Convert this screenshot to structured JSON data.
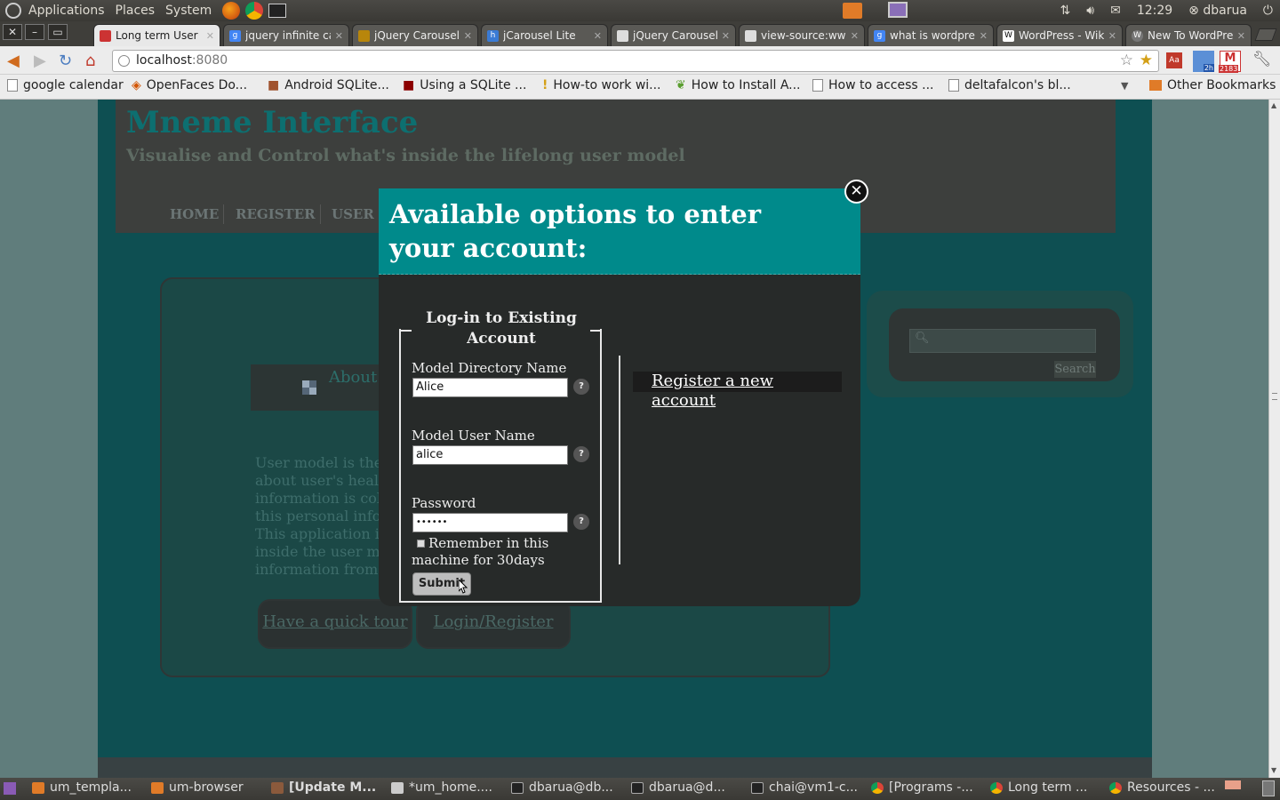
{
  "top_panel": {
    "menus": [
      "Applications",
      "Places",
      "System"
    ],
    "clock": "12:29",
    "user": "dbarua"
  },
  "tabs": [
    {
      "title": "Long term User M",
      "active": true
    },
    {
      "title": "jquery infinite ca",
      "active": false
    },
    {
      "title": "jQuery Carousel F",
      "active": false
    },
    {
      "title": "jCarousel Lite",
      "active": false
    },
    {
      "title": "jQuery Carousel",
      "active": false
    },
    {
      "title": "view-source:www",
      "active": false
    },
    {
      "title": "what is wordpres",
      "active": false
    },
    {
      "title": "WordPress - Wiki",
      "active": false
    },
    {
      "title": "New To WordPre",
      "active": false
    }
  ],
  "toolbar": {
    "url_host": "localhost",
    "url_port": ":8080",
    "ext_badge_1": "2h",
    "ext_badge_2": "2183"
  },
  "bookmarks": [
    "google calendar",
    "OpenFaces Do...",
    "Android SQLite...",
    "Using a SQLite ...",
    "How-to work wi...",
    "How to Install A...",
    "How to access ...",
    "deltafalcon's bl..."
  ],
  "other_bookmarks": "Other Bookmarks",
  "site": {
    "title": "Mneme Interface",
    "subtitle": "Visualise and Control what's inside the lifelong user model",
    "nav": [
      "HOME",
      "REGISTER",
      "USER M"
    ],
    "about_tab": "About",
    "about_text": [
      "User model is the r",
      "about user's health,",
      "information is colle",
      "this personal inform",
      "This application is",
      "inside the user moc",
      "information from th"
    ],
    "quick_tour": "Have a quick tour",
    "login_register": "Login/Register",
    "search_button": "Search"
  },
  "modal": {
    "title": "Available options to enter your account:",
    "legend": "Log-in to Existing Account",
    "dir_label": "Model Directory Name",
    "dir_value": "Alice",
    "user_label": "Model User Name",
    "user_value": "alice",
    "password_label": "Password",
    "password_value": "••••••",
    "help_glyph": "?",
    "remember_label": "Remember in this machine for 30days",
    "submit": "Submit",
    "register_link": "Register a new account",
    "close_glyph": "✕"
  },
  "taskbar": [
    "um_templa...",
    "um-browser",
    "[Update M...",
    "*um_home....",
    "dbarua@db...",
    "dbarua@d...",
    "chai@vm1-c...",
    "[Programs -...",
    "Long term ...",
    "Resources - ..."
  ]
}
